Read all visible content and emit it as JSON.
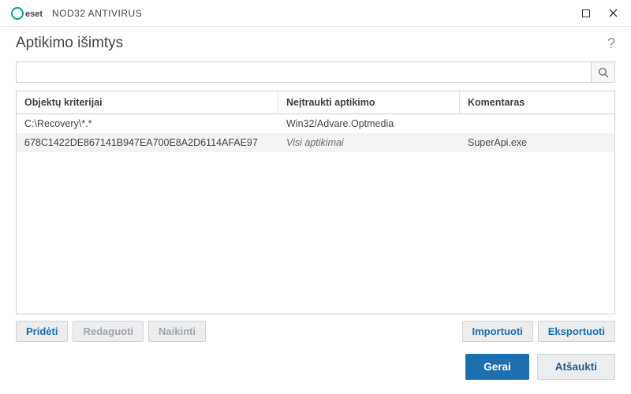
{
  "titlebar": {
    "product": "NOD32 ANTIVIRUS"
  },
  "header": {
    "title": "Aptikimo išimtys"
  },
  "search": {
    "placeholder": ""
  },
  "table": {
    "columns": {
      "c1": "Objektų kriterijai",
      "c2": "Neįtraukti aptikimo",
      "c3": "Komentaras"
    },
    "rows": [
      {
        "c1": "C:\\Recovery\\*.*",
        "c2": "Win32/Advare.Optmedia",
        "c2_italic": false,
        "c3": ""
      },
      {
        "c1": "678C1422DE867141B947EA700E8A2D6114AFAE97",
        "c2": "Visi aptikimai",
        "c2_italic": true,
        "c3": "SuperApi.exe"
      }
    ]
  },
  "toolbar": {
    "add": "Pridėti",
    "edit": "Redaguoti",
    "delete": "Naikinti",
    "import": "Importuoti",
    "export": "Eksportuoti"
  },
  "footer": {
    "ok": "Gerai",
    "cancel": "Atšaukti"
  }
}
